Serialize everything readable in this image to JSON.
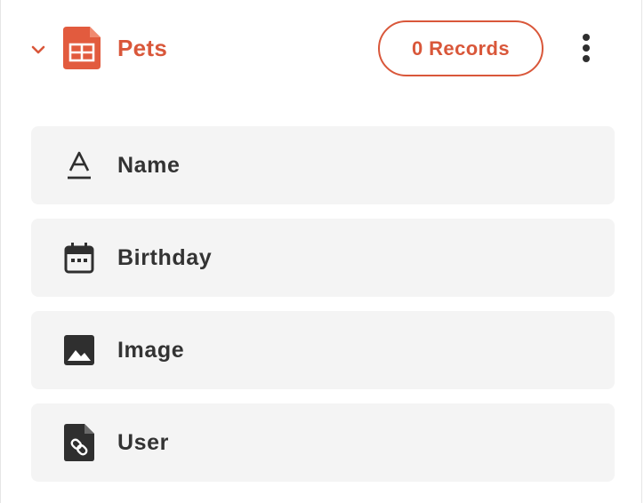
{
  "table": {
    "name": "Pets",
    "icon": "table-icon",
    "records_label": "0 Records",
    "accent_color": "#d9573a",
    "expanded": true
  },
  "fields": [
    {
      "label": "Name",
      "icon": "text-field-icon"
    },
    {
      "label": "Birthday",
      "icon": "calendar-icon"
    },
    {
      "label": "Image",
      "icon": "image-icon"
    },
    {
      "label": "User",
      "icon": "linked-document-icon"
    }
  ]
}
